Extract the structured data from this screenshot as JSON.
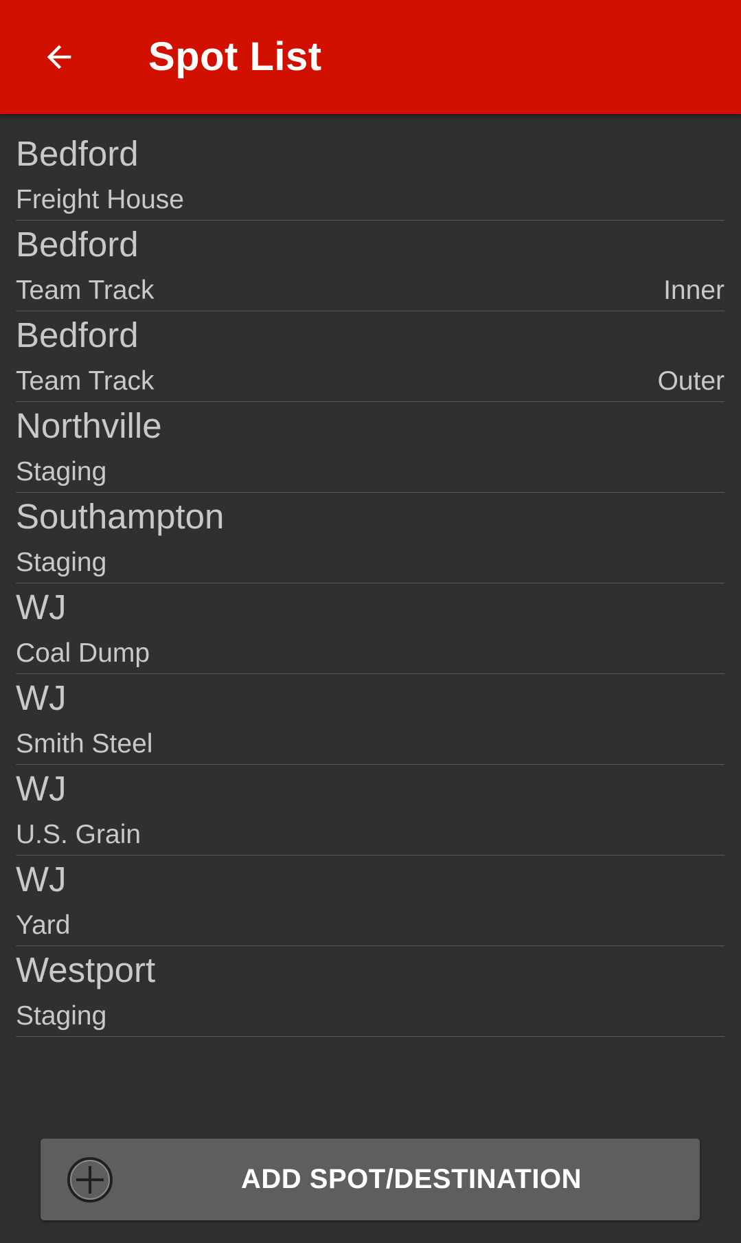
{
  "app_bar": {
    "title": "Spot List",
    "background": "#d11000",
    "back_icon": "arrow-left-icon"
  },
  "spots": [
    {
      "town": "Bedford",
      "industry": "Freight House",
      "track": ""
    },
    {
      "town": "Bedford",
      "industry": "Team Track",
      "track": "Inner"
    },
    {
      "town": "Bedford",
      "industry": "Team Track",
      "track": "Outer"
    },
    {
      "town": "Northville",
      "industry": "Staging",
      "track": ""
    },
    {
      "town": "Southampton",
      "industry": "Staging",
      "track": ""
    },
    {
      "town": "WJ",
      "industry": "Coal Dump",
      "track": ""
    },
    {
      "town": "WJ",
      "industry": "Smith Steel",
      "track": ""
    },
    {
      "town": "WJ",
      "industry": "U.S. Grain",
      "track": ""
    },
    {
      "town": "WJ",
      "industry": "Yard",
      "track": ""
    },
    {
      "town": "Westport",
      "industry": "Staging",
      "track": ""
    }
  ],
  "add_button": {
    "label": "ADD SPOT/DESTINATION",
    "icon": "add-circle-icon"
  }
}
